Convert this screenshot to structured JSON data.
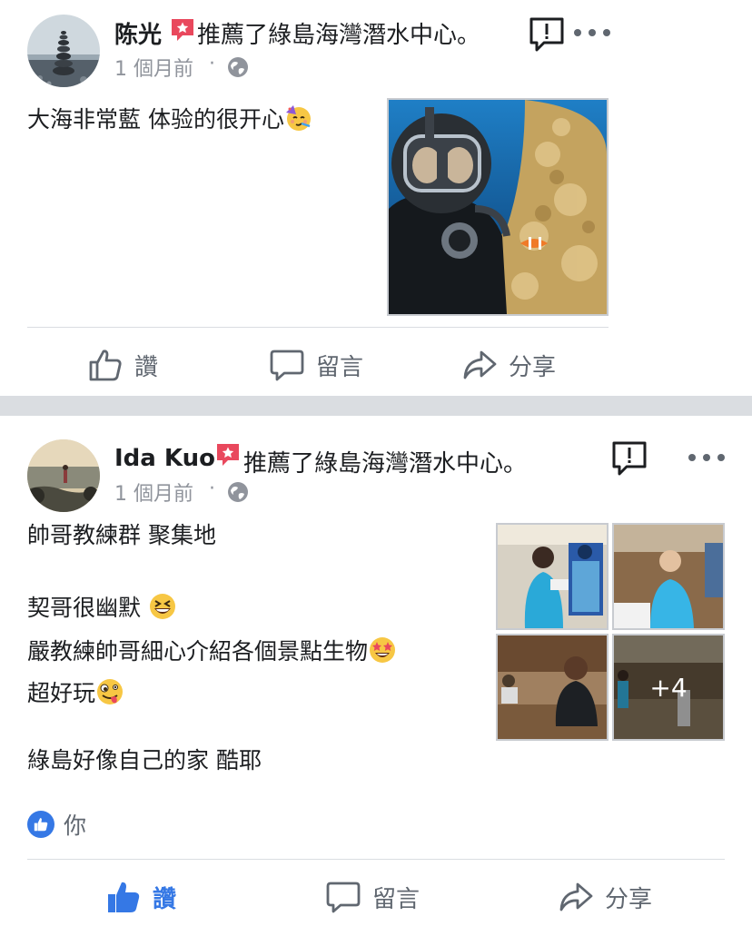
{
  "posts": [
    {
      "author": "陈光",
      "recommend_text": "推薦了綠島海灣潛水中心。",
      "time": "1 個月前",
      "separator": "·",
      "text_lines": [
        "大海非常藍 体验的很开心"
      ],
      "emoji": [
        "partying-face-emoji"
      ],
      "photo_count_extra": null,
      "actions": {
        "like": "讚",
        "comment": "留言",
        "share": "分享"
      },
      "liked": false
    },
    {
      "author": "Ida Kuo",
      "recommend_text": "推薦了綠島海灣潛水中心。",
      "time": "1 個月前",
      "separator": "·",
      "text_lines": [
        "帥哥教練群 聚集地",
        "契哥很幽默",
        "嚴教練帥哥細心介紹各個景點生物",
        "超好玩",
        "綠島好像自己的家 酷耶"
      ],
      "emoji": [
        "grinning-squinting-face-emoji",
        "star-struck-emoji",
        "zany-face-emoji"
      ],
      "photo_count_extra": "+4",
      "reactions": {
        "who": "你"
      },
      "actions": {
        "like": "讚",
        "comment": "留言",
        "share": "分享"
      },
      "liked": true
    }
  ],
  "icons": {
    "recommend": "recommend-star-icon",
    "globe": "globe-icon",
    "report": "report-icon",
    "more": "more-icon",
    "like": "thumbs-up-icon",
    "comment": "comment-bubble-icon",
    "share": "share-arrow-icon"
  },
  "colors": {
    "accent": "#3578e5",
    "recommend_red": "#e9485d",
    "muted": "#90949c",
    "divider": "#dadde1"
  }
}
